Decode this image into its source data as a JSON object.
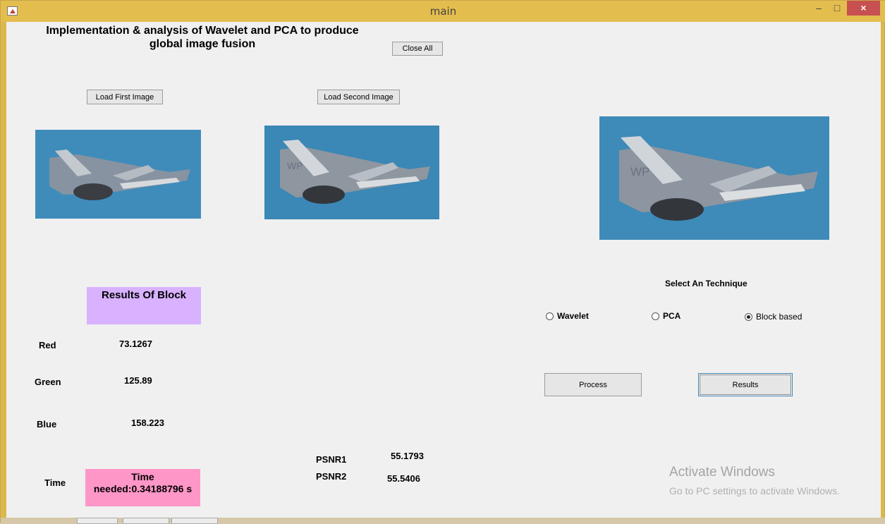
{
  "window": {
    "title": "main"
  },
  "controls": {
    "minimize": "–",
    "maximize": "□",
    "close": "×"
  },
  "heading": "Implementation & analysis of Wavelet and PCA to produce global image fusion",
  "buttons": {
    "close_all": "Close All",
    "load_first": "Load First Image",
    "load_second": "Load Second Image",
    "process": "Process",
    "results": "Results"
  },
  "results_panel": {
    "title": "Results Of Block"
  },
  "metrics": [
    {
      "label": "Red",
      "value": "73.1267"
    },
    {
      "label": "Green",
      "value": "125.89"
    },
    {
      "label": "Blue",
      "value": "158.223"
    }
  ],
  "time": {
    "label": "Time",
    "value": "Time needed:0.34188796 s"
  },
  "psnr": [
    {
      "label": "PSNR1",
      "value": "55.1793"
    },
    {
      "label": "PSNR2",
      "value": "55.5406"
    }
  ],
  "technique": {
    "heading": "Select An Technique",
    "options": [
      {
        "label": "Wavelet",
        "selected": false
      },
      {
        "label": "PCA",
        "selected": false
      },
      {
        "label": "Block based",
        "selected": true
      }
    ]
  },
  "watermark": {
    "line1": "Activate Windows",
    "line2": "Go to PC settings to activate Windows."
  },
  "colors": {
    "title_bar": "#e3bd4e",
    "close_red": "#c75050",
    "purple_panel": "#d8b2ff",
    "pink_panel": "#ff96c8",
    "sky_blue": "#3d89b6"
  }
}
